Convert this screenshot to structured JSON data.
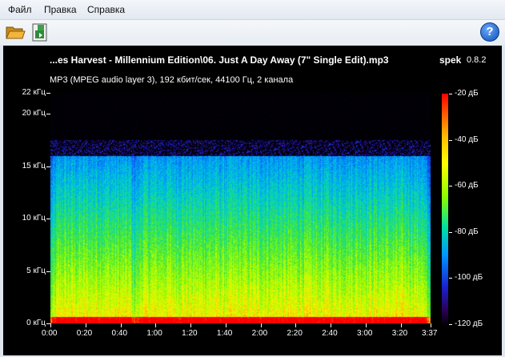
{
  "menu": {
    "file": "Файл",
    "edit": "Правка",
    "help": "Справка"
  },
  "toolbar": {
    "open_icon": "folder-open-icon",
    "save_icon": "save-icon",
    "help_icon": "help-icon",
    "help_glyph": "?"
  },
  "header": {
    "title": "...es Harvest - Millennium Edition\\06. Just A Day Away (7\" Single Edit).mp3",
    "app_name": "spek",
    "app_version": "0.8.2",
    "format_info": "MP3 (MPEG audio layer 3), 192 кбит/сек, 44100 Гц, 2 канала"
  },
  "colors": {
    "background": "#000000",
    "text": "#ffffff"
  },
  "chart_data": {
    "type": "heatmap",
    "x_ticks": [
      "0:00",
      "0:20",
      "0:40",
      "1:00",
      "1:20",
      "1:40",
      "2:00",
      "2:20",
      "2:40",
      "3:00",
      "3:20",
      "3:37"
    ],
    "x_range_seconds": [
      0,
      217
    ],
    "y_ticks": [
      "0 кГц",
      "5 кГц",
      "10 кГц",
      "15 кГц",
      "20 кГц",
      "22 кГц"
    ],
    "y_range_khz": [
      0,
      22
    ],
    "colorbar_ticks": [
      "-20 дБ",
      "-40 дБ",
      "-60 дБ",
      "-80 дБ",
      "-100 дБ",
      "-120 дБ"
    ],
    "colorbar_range_db": [
      -120,
      -20
    ],
    "cutoff_khz": 16
  }
}
